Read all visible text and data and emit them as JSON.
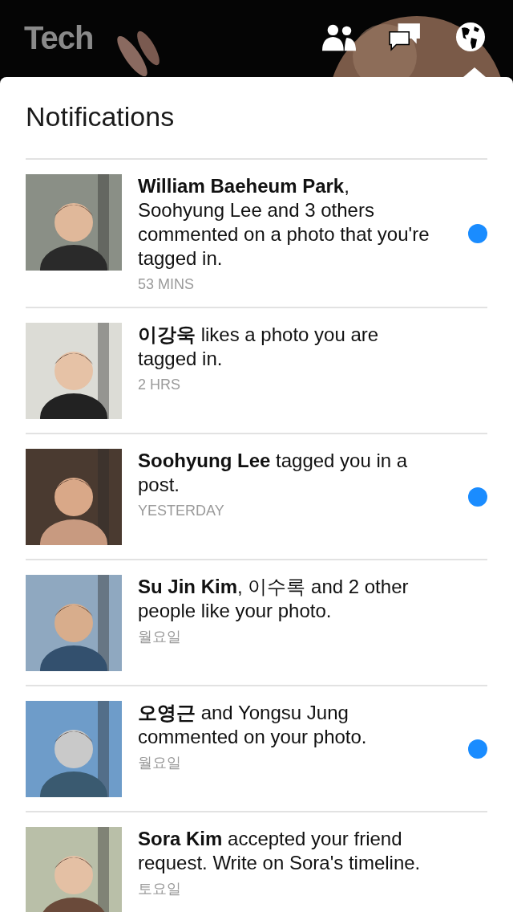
{
  "header": {
    "title": "Tech"
  },
  "panel": {
    "title": "Notifications"
  },
  "notifications": [
    {
      "text": "**William Baeheum Park**, Soohyung Lee and 3 others commented on a photo that you're tagged in.",
      "time": "53 MINS",
      "unread": true
    },
    {
      "text": "**이강욱** likes a photo you are tagged in.",
      "time": "2 HRS",
      "unread": false
    },
    {
      "text": "**Soohyung Lee** tagged you in a post.",
      "time": "YESTERDAY",
      "unread": true
    },
    {
      "text": "**Su Jin Kim**, 이수록 and 2 other people like your photo.",
      "time": "월요일",
      "unread": false
    },
    {
      "text": "**오영근** and Yongsu Jung commented on your photo.",
      "time": "월요일",
      "unread": true
    },
    {
      "text": "**Sora Kim** accepted your friend request. Write on Sora's timeline.",
      "time": "토요일",
      "unread": false
    }
  ]
}
